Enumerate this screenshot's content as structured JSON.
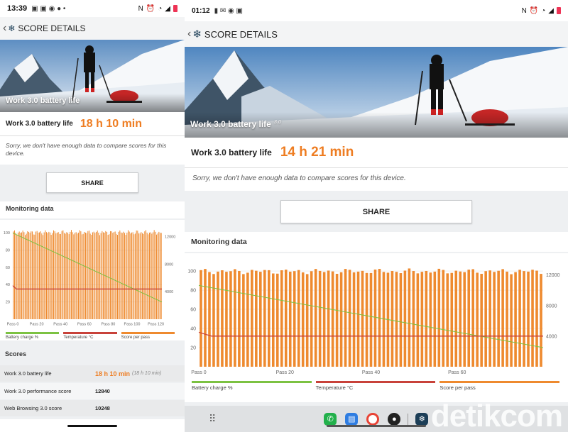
{
  "phone": {
    "status": {
      "time": "13:39",
      "icons": [
        "M",
        "M",
        "chat-icon",
        "mail-icon",
        "•"
      ],
      "right": [
        "N",
        "⏰",
        "wifi",
        "battery"
      ]
    },
    "title": "SCORE DETAILS",
    "hero_title": "Work 3.0 battery life",
    "result_label": "Work 3.0 battery life",
    "result_value": "18 h 10 min",
    "note": "Sorry, we don't have enough data to compare scores for this device.",
    "share": "SHARE",
    "monitoring_title": "Monitoring data",
    "scores_title": "Scores",
    "scores": [
      {
        "name": "Work 3.0 battery life",
        "value": "18 h 10 min",
        "sub": "(18 h 10 min)"
      },
      {
        "name": "Work 3.0 performance score",
        "value": "12840",
        "sub": ""
      },
      {
        "name": "Web Browsing 3.0 score",
        "value": "10248",
        "sub": ""
      }
    ]
  },
  "tablet": {
    "status": {
      "time": "01:12",
      "icons": [
        "M",
        "mail-icon",
        "phone-icon",
        "screen-icon"
      ],
      "right": [
        "N",
        "⏰",
        "wifi",
        "battery"
      ]
    },
    "title": "SCORE DETAILS",
    "hero_title": "Work 3.0 battery life",
    "hero_version": "3.0",
    "result_label": "Work 3.0 battery life",
    "result_value": "14 h 21 min",
    "note": "Sorry, we don't have enough data to compare scores for this device.",
    "share": "SHARE",
    "monitoring_title": "Monitoring data",
    "dock": [
      "phone-app-icon",
      "messages-app-icon",
      "chrome-app-icon",
      "camera-app-icon",
      "3dmark-app-icon"
    ]
  },
  "watermark": "detikcom",
  "legend": {
    "battery": "Battery charge %",
    "temperature": "Temperature °C",
    "score": "Score per pass"
  },
  "colors": {
    "battery": "#7cc242",
    "temperature": "#c8423a",
    "score": "#ee8a2f",
    "value": "#ee7d22"
  },
  "chart_data": [
    {
      "type": "bar",
      "title": "Monitoring data",
      "x_ticks": [
        "Pass 0",
        "Pass 20",
        "Pass 40",
        "Pass 60",
        "Pass 80",
        "Pass 100",
        "Pass 120"
      ],
      "y_left_ticks": [
        100,
        80,
        60,
        40,
        20
      ],
      "y_right_ticks": [
        12000,
        8000,
        4000
      ],
      "passes": 126,
      "series": [
        {
          "name": "Score per pass",
          "y_right_mean": 12600
        },
        {
          "name": "Battery charge %",
          "start": 100,
          "end": 20
        },
        {
          "name": "Temperature °C",
          "value": 35
        }
      ]
    },
    {
      "type": "bar",
      "title": "Monitoring data",
      "x_ticks": [
        "Pass 0",
        "Pass 20",
        "Pass 40",
        "Pass 60"
      ],
      "y_left_ticks": [
        100,
        80,
        60,
        40,
        20
      ],
      "y_right_ticks": [
        12000,
        8000,
        4000
      ],
      "passes": 81,
      "series": [
        {
          "name": "Score per pass",
          "y_right_mean": 12500
        },
        {
          "name": "Battery charge %",
          "start": 85,
          "end": 20
        },
        {
          "name": "Temperature °C",
          "value": 32
        }
      ]
    }
  ]
}
